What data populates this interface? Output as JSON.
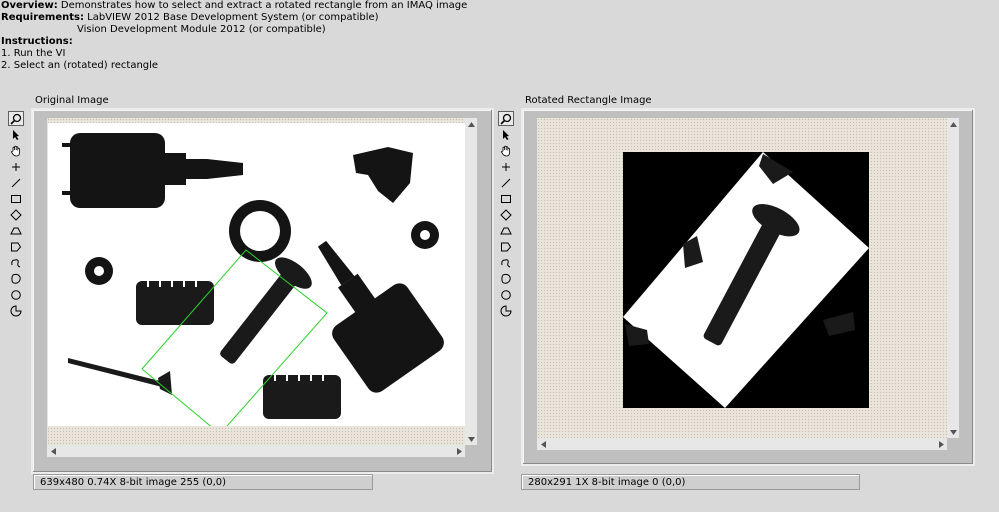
{
  "info": {
    "overview_label": "Overview:",
    "overview_text": "Demonstrates how to select and extract a rotated rectangle from an IMAQ image",
    "requirements_label": "Requirements:",
    "requirements_line1": "LabVIEW 2012 Base Development System (or compatible)",
    "requirements_line2": "Vision Development Module 2012 (or compatible)",
    "instructions_label": "Instructions:",
    "step1": "1. Run the VI",
    "step2": "2. Select an (rotated) rectangle"
  },
  "left_panel": {
    "caption": "Original Image",
    "status": "639x480 0.74X 8-bit image 255     (0,0)"
  },
  "right_panel": {
    "caption": "Rotated Rectangle Image",
    "status": "280x291 1X 8-bit image 0     (0,0)"
  },
  "tools": [
    "zoom-tool-icon",
    "pointer-tool-icon",
    "pan-hand-icon",
    "crosshair-point-icon",
    "line-tool-icon",
    "rectangle-tool-icon",
    "rotated-rectangle-tool-icon",
    "annulus-tool-icon",
    "polygon-tool-icon",
    "freehand-tool-icon",
    "freehand-region-icon",
    "oval-tool-icon",
    "broken-line-tool-icon"
  ],
  "colors": {
    "roi": "#2bd12b",
    "background": "#d9d9d9"
  }
}
